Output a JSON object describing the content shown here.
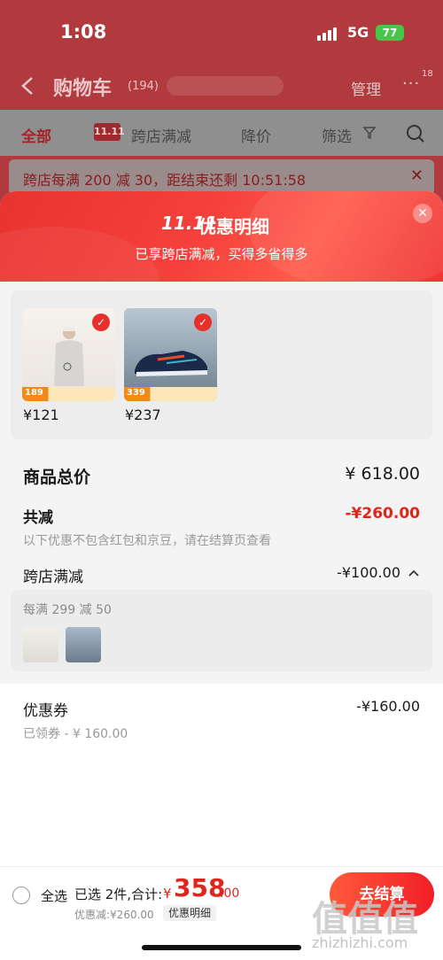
{
  "status_bar": {
    "time": "1:08",
    "network": "5G",
    "battery": "77"
  },
  "nav": {
    "title": "购物车",
    "count": "(194)",
    "manage": "管理",
    "more": "···",
    "badge": "18"
  },
  "filters": {
    "all": "全部",
    "tag": "11.11",
    "cross_store": "跨店满减",
    "price_drop": "降价",
    "filter": "筛选"
  },
  "promo_banner": {
    "text": "跨店每满 200 减 30，距结束还剩 10:51:58"
  },
  "sheet": {
    "logo": "11.11",
    "title": "优惠明细",
    "subtitle": "已享跨店满减，买得多省得多",
    "items": [
      {
        "price": "¥121",
        "strip": "189"
      },
      {
        "price": "¥237",
        "strip": "339"
      }
    ],
    "total_label": "商品总价",
    "total_value": "¥ 618.00",
    "reduce_label": "共减",
    "reduce_value": "-¥260.00",
    "reduce_note": "以下优惠不包含红包和京豆，请在结算页查看",
    "cross_label": "跨店满减",
    "cross_value": "-¥100.00",
    "cross_rule": "每满 299 减 50",
    "coupon_label": "优惠券",
    "coupon_value": "-¥160.00",
    "coupon_note": "已领券 - ¥ 160.00"
  },
  "bottom": {
    "select_all": "全选",
    "selected": "已选 2件,合计:",
    "currency": "¥",
    "total_int": "358",
    "total_dec": ".00",
    "saved": "优惠减:¥260.00",
    "detail": "优惠明细",
    "checkout": "去结算"
  },
  "watermark": {
    "logo": "值值值",
    "url": "zhizhizhi.com"
  },
  "colors": {
    "accent": "#e1251b",
    "header": "#f0403a",
    "background_dim": "#b03a3e"
  }
}
